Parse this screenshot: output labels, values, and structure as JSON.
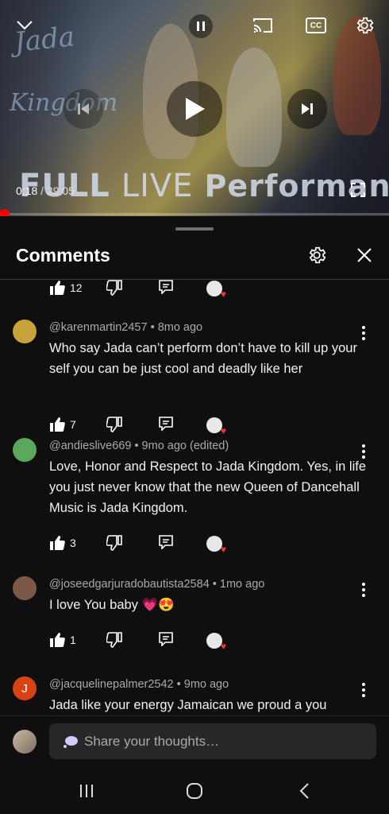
{
  "player": {
    "time_current": "0:18",
    "time_separator": " / ",
    "time_total": "29:05",
    "progress_fraction": 0.0103,
    "watermark_line1": "Jada",
    "watermark_line2": "Kingdom",
    "banner_word1": "FULL",
    "banner_word2": "LIVE",
    "banner_word3": "Performance",
    "cc_label": "CC"
  },
  "comments_panel": {
    "title": "Comments",
    "top_partial_like_count": "12"
  },
  "comments": [
    {
      "author": "@karenmartin2457",
      "time": "8mo ago",
      "edited": "",
      "text": "Who say Jada can’t  perform  don’t  have to kill up your self you can be just cool and deadly like her",
      "likes": "7",
      "avatar_color": "#c8a33a"
    },
    {
      "author": "@andieslive669",
      "time": "9mo ago",
      "edited": "(edited)",
      "text": "Love, Honor and Respect to Jada Kingdom. Yes, in life you just never know that the new Queen of Dancehall Music is Jada Kingdom.",
      "likes": "3",
      "avatar_color": "#5ca85a"
    },
    {
      "author": "@joseedgarjuradobautista2584",
      "time": "1mo ago",
      "edited": "",
      "text": "I love You baby 💗😍",
      "likes": "1",
      "avatar_color": "#7a5a46"
    },
    {
      "author": "@jacquelinepalmer2542",
      "time": "9mo ago",
      "edited": "",
      "text": "Jada like your energy Jamaican we proud a you",
      "avatar_letter": "J",
      "avatar_color": "#d84315"
    }
  ],
  "composer": {
    "placeholder": "Share your thoughts…"
  },
  "colors": {
    "background": "#0f0f0f",
    "meta_text": "#aaaaaa",
    "progress": "#ff0000",
    "field": "#272727"
  },
  "icons": [
    "chevron-down-icon",
    "pause-icon",
    "cast-icon",
    "cc-icon",
    "settings-icon",
    "previous-icon",
    "play-icon",
    "next-icon",
    "fullscreen-icon",
    "close-icon",
    "like-icon",
    "dislike-icon",
    "reply-icon",
    "more-vertical-icon",
    "recents-icon",
    "home-icon",
    "back-icon"
  ]
}
